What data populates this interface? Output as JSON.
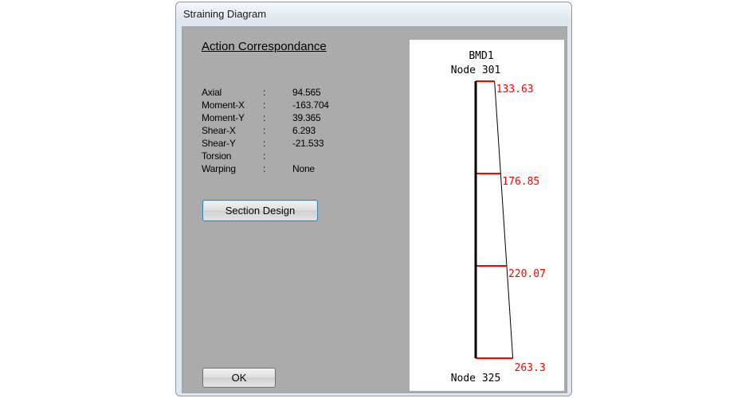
{
  "window": {
    "title": "Straining Diagram"
  },
  "section": {
    "heading": "Action Correspondance"
  },
  "properties": [
    {
      "name": "Axial",
      "value": "94.565"
    },
    {
      "name": "Moment-X",
      "value": "-163.704"
    },
    {
      "name": "Moment-Y",
      "value": "39.365"
    },
    {
      "name": "Shear-X",
      "value": "6.293"
    },
    {
      "name": "Shear-Y",
      "value": "-21.533"
    },
    {
      "name": "Torsion",
      "value": ""
    },
    {
      "name": "Warping",
      "value": "None"
    }
  ],
  "separator": ":",
  "buttons": {
    "section_design": "Section Design",
    "ok": "OK"
  },
  "diagram": {
    "title": "BMD1",
    "start_node": "Node 301",
    "end_node": "Node 325",
    "colors": {
      "member": "#000000",
      "ordinate": "#ff0000",
      "label": "#ff0000",
      "outline": "#000000"
    },
    "points": [
      {
        "position": 0.0,
        "value": 133.63,
        "label": "133.63"
      },
      {
        "position": 0.3333,
        "value": 176.85,
        "label": "176.85"
      },
      {
        "position": 0.6667,
        "value": 220.07,
        "label": "220.07"
      },
      {
        "position": 1.0,
        "value": 263.3,
        "label": "263.3"
      }
    ]
  }
}
